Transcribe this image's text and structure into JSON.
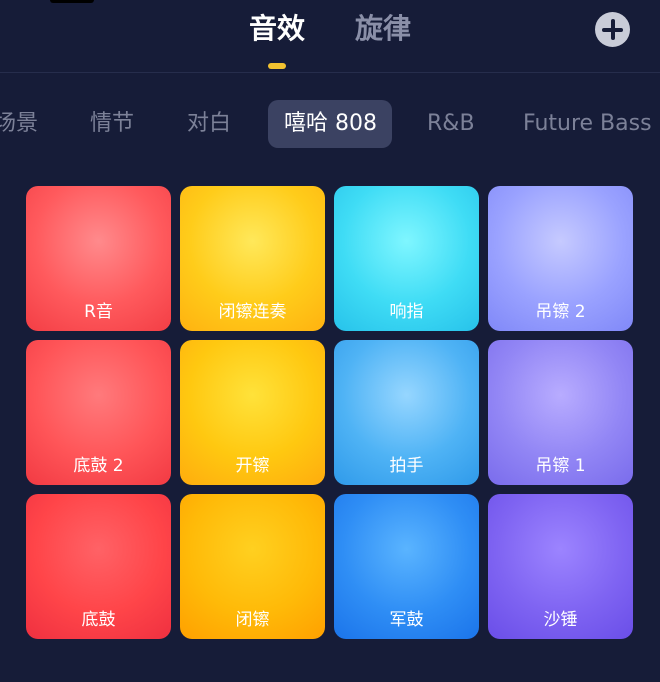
{
  "mode_tabs": [
    {
      "label": "音效",
      "active": true
    },
    {
      "label": "旋律",
      "active": false
    }
  ],
  "add_button": {
    "icon": "plus-circle-icon"
  },
  "categories": [
    {
      "label": "场景",
      "active": false
    },
    {
      "label": "情节",
      "active": false
    },
    {
      "label": "对白",
      "active": false
    },
    {
      "label": "嘻哈 808",
      "active": true
    },
    {
      "label": "R&B",
      "active": false
    },
    {
      "label": "Future Bass",
      "active": false
    }
  ],
  "pads": [
    {
      "label": "R音",
      "color": "#ff5a5d"
    },
    {
      "label": "闭镲连奏",
      "color": "#ffcc1a"
    },
    {
      "label": "响指",
      "color": "#3fdcf5"
    },
    {
      "label": "吊镲 2",
      "color": "#9aa2ff"
    },
    {
      "label": "底鼓 2",
      "color": "#ff5558"
    },
    {
      "label": "开镲",
      "color": "#ffc810"
    },
    {
      "label": "拍手",
      "color": "#4fb3f5"
    },
    {
      "label": "吊镲 1",
      "color": "#9286f5"
    },
    {
      "label": "底鼓",
      "color": "#ff4549"
    },
    {
      "label": "闭镲",
      "color": "#ffba08"
    },
    {
      "label": "军鼓",
      "color": "#2f8ef5"
    },
    {
      "label": "沙锤",
      "color": "#7f64f2"
    }
  ],
  "colors": {
    "background": "#161c38",
    "accent": "#f2c230",
    "active_category_bg": "#3b4262"
  }
}
